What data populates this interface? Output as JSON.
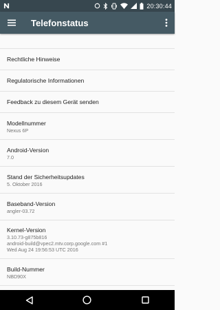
{
  "status_bar": {
    "time": "20:30:44",
    "icons": [
      "notification-n-icon",
      "sync-icon",
      "bluetooth-icon",
      "vibrate-icon",
      "wifi-icon",
      "signal-icon",
      "battery-icon"
    ]
  },
  "app_bar": {
    "title": "Telefonstatus",
    "menu_icon": "hamburger-menu-icon",
    "overflow_icon": "overflow-menu-icon"
  },
  "list": {
    "items": [
      {
        "title": "Rechtliche Hinweise"
      },
      {
        "title": "Regulatorische Informationen"
      },
      {
        "title": "Feedback zu diesem Gerät senden"
      },
      {
        "title": "Modellnummer",
        "subtitle": "Nexus 6P"
      },
      {
        "title": "Android-Version",
        "subtitle": "7.0"
      },
      {
        "title": "Stand der Sicherheitsupdates",
        "subtitle": "5. Oktober 2016"
      },
      {
        "title": "Baseband-Version",
        "subtitle": "angler-03.72"
      },
      {
        "title": "Kernel-Version",
        "subtitle": "3.10.73-g875b816",
        "subtitle2": "android-build@vpec2.mtv.corp.google.com #1",
        "subtitle3": "Wed Aug 24 19:56:53 UTC 2016"
      },
      {
        "title": "Build-Nummer",
        "subtitle": "NBD90X"
      }
    ]
  },
  "nav_bar": {
    "back_icon": "back-triangle-icon",
    "home_icon": "home-circle-icon",
    "recents_icon": "recents-square-icon"
  },
  "colors": {
    "status_bar": "#37474f",
    "app_bar": "#455a64",
    "background": "#fafafa",
    "nav_bar": "#000000"
  }
}
